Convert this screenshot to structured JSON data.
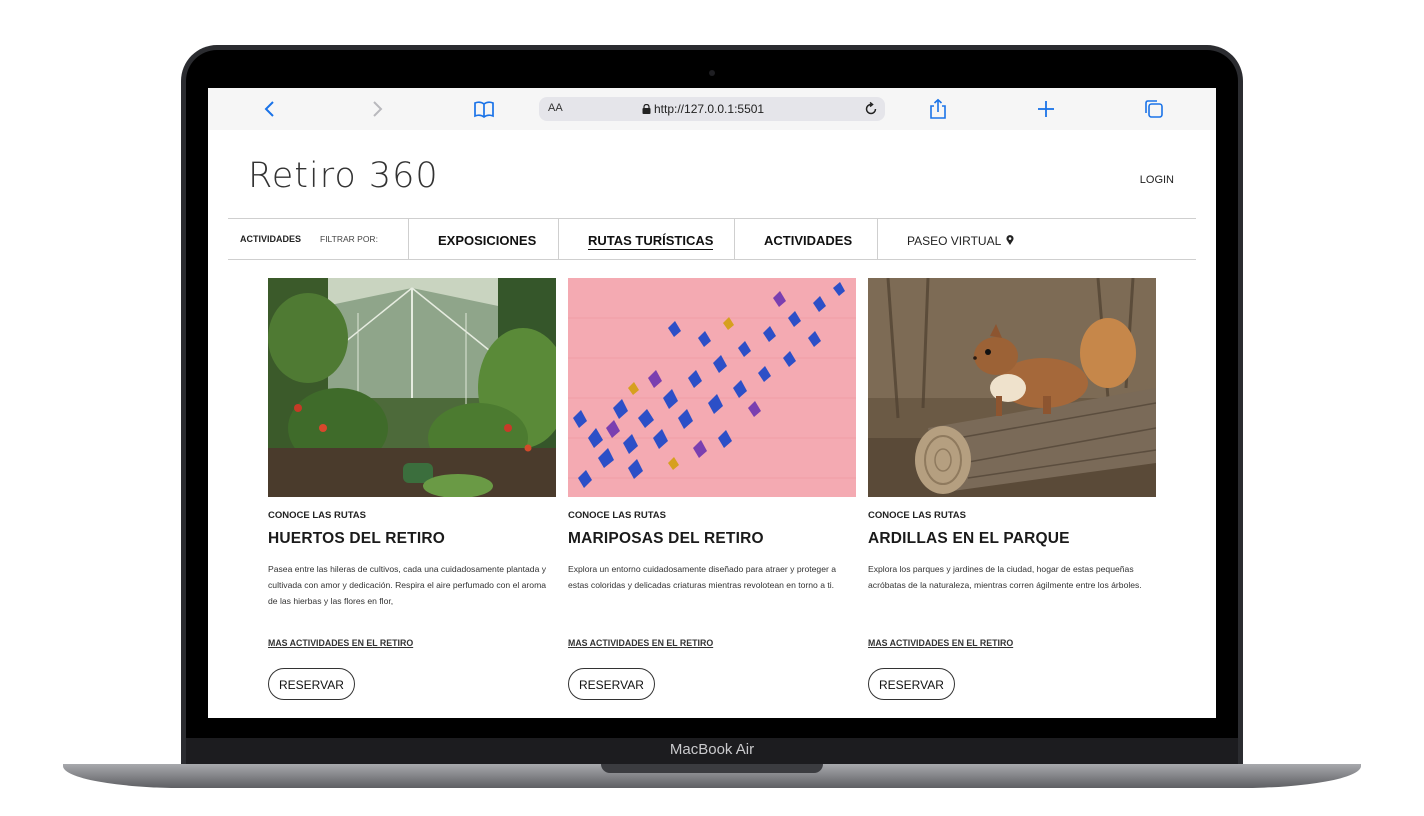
{
  "device": {
    "label": "MacBook Air"
  },
  "browser": {
    "text_size_label": "AA",
    "url": "http://127.0.0.1:5501",
    "icons": [
      "back-icon",
      "forward-icon",
      "bookmarks-icon",
      "lock-icon",
      "reload-icon",
      "share-icon",
      "new-tab-icon",
      "tabs-icon"
    ],
    "accent_color": "#1a73e8"
  },
  "site": {
    "logo": "Retiro 360",
    "login": "LOGIN"
  },
  "nav": {
    "section_label": "ACTIVIDADES",
    "filter_label": "FILTRAR POR:",
    "tabs": [
      {
        "label": "EXPOSICIONES",
        "active": false
      },
      {
        "label": "RUTAS TURÍSTICAS",
        "active": true
      },
      {
        "label": "ACTIVIDADES",
        "active": false
      }
    ],
    "virtual": "PASEO VIRTUAL",
    "virtual_icon": "map-pin-icon"
  },
  "cards": [
    {
      "image": "greenhouse-garden",
      "kicker": "CONOCE LAS RUTAS",
      "title": "HUERTOS DEL RETIRO",
      "description": "Pasea entre las hileras de cultivos, cada una cuidadosamente plantada y cultivada con amor y dedicación. Respira el aire perfumado con el aroma de las hierbas y las flores en flor,",
      "link": "MAS ACTIVIDADES EN EL RETIRO",
      "button": "RESERVAR"
    },
    {
      "image": "butterflies-pink-wall",
      "kicker": "CONOCE LAS RUTAS",
      "title": "MARIPOSAS DEL RETIRO",
      "description": "Explora un entorno cuidadosamente diseñado para atraer y proteger a estas coloridas y delicadas criaturas mientras revolotean en torno a ti.",
      "link": "MAS ACTIVIDADES EN EL RETIRO",
      "button": "RESERVAR"
    },
    {
      "image": "squirrel-on-log",
      "kicker": "CONOCE LAS RUTAS",
      "title": "ARDILLAS EN EL PARQUE",
      "description": "Explora los parques y jardines de la ciudad, hogar de estas pequeñas acróbatas de la naturaleza, mientras corren ágilmente entre los árboles.",
      "link": "MAS ACTIVIDADES EN EL RETIRO",
      "button": "RESERVAR"
    }
  ]
}
